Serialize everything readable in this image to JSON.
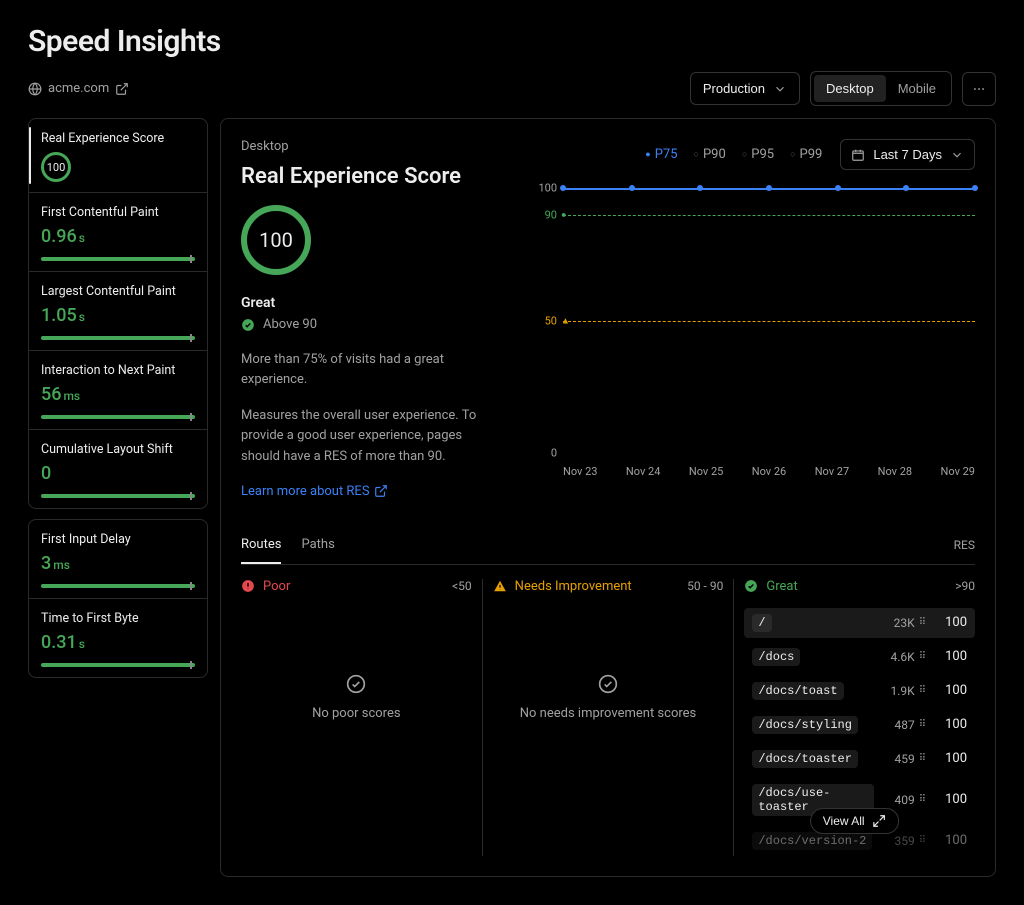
{
  "header": {
    "title": "Speed Insights"
  },
  "sublink": {
    "domain": "acme.com"
  },
  "env_selector": {
    "label": "Production"
  },
  "device_seg": {
    "desktop": "Desktop",
    "mobile": "Mobile"
  },
  "date_range": {
    "label": "Last 7 Days"
  },
  "sidebar": {
    "res": {
      "label": "Real Experience Score",
      "value": "100"
    },
    "fcp": {
      "label": "First Contentful Paint",
      "value": "0.96",
      "unit": "s"
    },
    "lcp": {
      "label": "Largest Contentful Paint",
      "value": "1.05",
      "unit": "s"
    },
    "inp": {
      "label": "Interaction to Next Paint",
      "value": "56",
      "unit": "ms"
    },
    "cls": {
      "label": "Cumulative Layout Shift",
      "value": "0",
      "unit": ""
    },
    "fid": {
      "label": "First Input Delay",
      "value": "3",
      "unit": "ms"
    },
    "ttfb": {
      "label": "Time to First Byte",
      "value": "0.31",
      "unit": "s"
    }
  },
  "main": {
    "device": "Desktop",
    "metric_title": "Real Experience Score",
    "big_value": "100",
    "rating": "Great",
    "threshold_text": "Above 90",
    "summary": "More than 75% of visits had a great experience.",
    "desc": "Measures the overall user experience. To provide a good user experience, pages should have a RES of more than 90.",
    "learn_link": "Learn more about RES"
  },
  "percentiles": {
    "p75": "P75",
    "p90": "P90",
    "p95": "P95",
    "p99": "P99"
  },
  "yticks": {
    "t100": "100",
    "t90": "90",
    "t50": "50",
    "t0": "0"
  },
  "xticks": [
    "Nov 23",
    "Nov 24",
    "Nov 25",
    "Nov 26",
    "Nov 27",
    "Nov 28",
    "Nov 29"
  ],
  "routes_header": {
    "tab_routes": "Routes",
    "tab_paths": "Paths",
    "metric": "RES"
  },
  "cols": {
    "poor": {
      "title": "Poor",
      "range": "<50",
      "empty": "No poor scores"
    },
    "needs": {
      "title": "Needs Improvement",
      "range": "50 - 90",
      "empty": "No needs improvement scores"
    },
    "great": {
      "title": "Great",
      "range": ">90"
    }
  },
  "routes": [
    {
      "path": "/",
      "count": "23K",
      "score": "100"
    },
    {
      "path": "/docs",
      "count": "4.6K",
      "score": "100"
    },
    {
      "path": "/docs/toast",
      "count": "1.9K",
      "score": "100"
    },
    {
      "path": "/docs/styling",
      "count": "487",
      "score": "100"
    },
    {
      "path": "/docs/toaster",
      "count": "459",
      "score": "100"
    },
    {
      "path": "/docs/use-toaster",
      "count": "409",
      "score": "100"
    },
    {
      "path": "/docs/version-2",
      "count": "359",
      "score": "100"
    }
  ],
  "view_all": "View All",
  "chart_data": {
    "type": "line",
    "title": "Real Experience Score",
    "categories": [
      "Nov 23",
      "Nov 24",
      "Nov 25",
      "Nov 26",
      "Nov 27",
      "Nov 28",
      "Nov 29"
    ],
    "series": [
      {
        "name": "P75",
        "values": [
          100,
          100,
          100,
          100,
          100,
          100,
          100
        ]
      }
    ],
    "ylim": [
      0,
      100
    ],
    "thresholds": {
      "good": 90,
      "needs_improvement": 50
    },
    "ylabel": "",
    "xlabel": ""
  }
}
